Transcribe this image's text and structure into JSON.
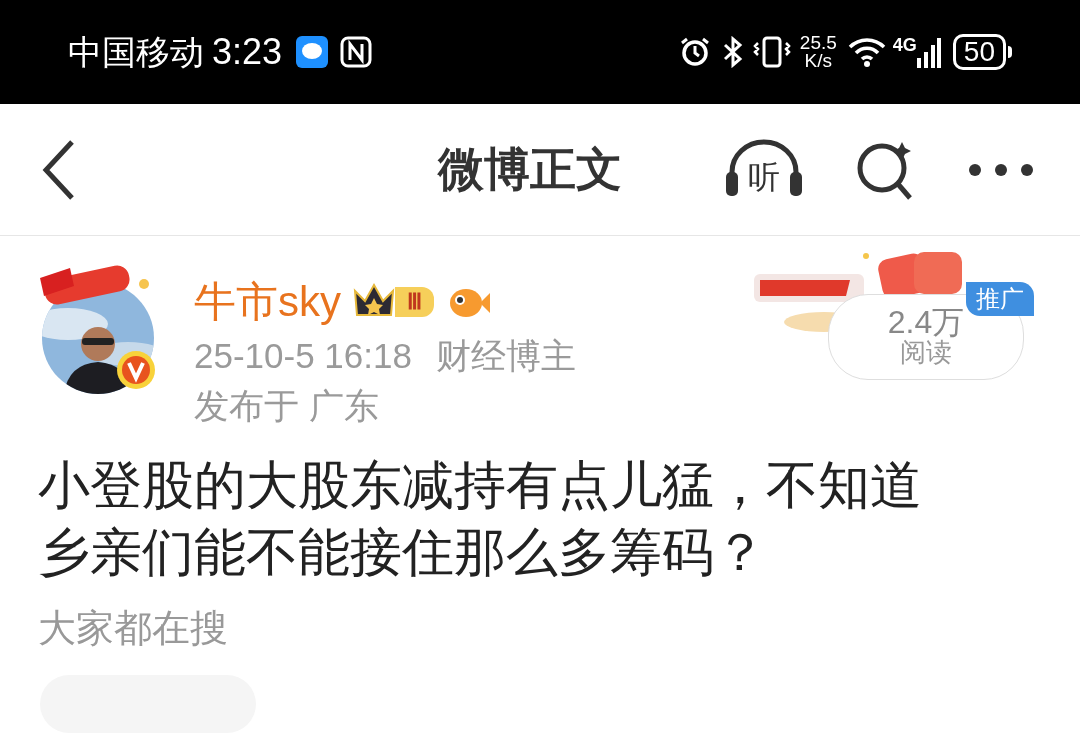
{
  "status_bar": {
    "carrier": "中国移动",
    "time": "3:23",
    "net_speed": "25.5",
    "net_speed_unit": "K/s",
    "network": "4G",
    "battery": "50"
  },
  "nav": {
    "title": "微博正文",
    "listen_label": "听"
  },
  "post": {
    "author": "牛市sky",
    "rank": "Ⅲ",
    "verified": true,
    "time": "25-10-5 16:18",
    "role": "财经博主",
    "location": "发布于 广东",
    "reads": "2.4万",
    "reads_label": "阅读",
    "promo_tag": "推广",
    "text": "小登股的大股东减持有点儿猛，不知道乡亲们能不能接住那么多筹码？"
  },
  "trending": {
    "title": "大家都在搜"
  }
}
